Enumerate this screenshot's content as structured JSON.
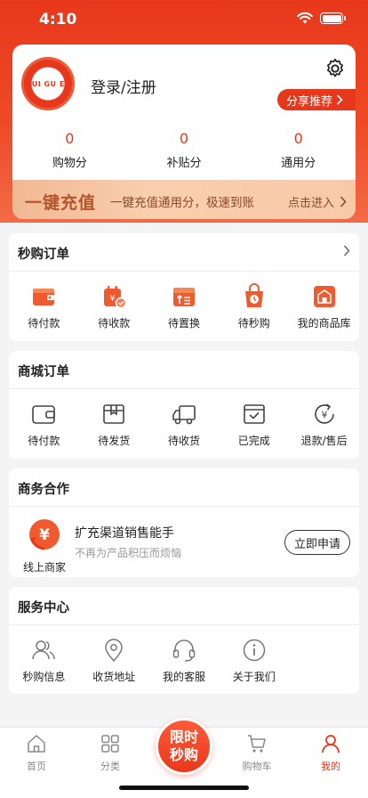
{
  "status_bar": {
    "time": "4:10"
  },
  "profile": {
    "logo_text": "HUI GU ER",
    "login_label": "登录/注册",
    "share_label": "分享推荐",
    "stats": [
      {
        "value": "0",
        "label": "购物分"
      },
      {
        "value": "0",
        "label": "补贴分"
      },
      {
        "value": "0",
        "label": "通用分"
      }
    ]
  },
  "recharge": {
    "title": "一键充值",
    "desc": "一键充值通用分，极速到账",
    "enter": "点击进入"
  },
  "flash_orders": {
    "title": "秒购订单",
    "items": [
      {
        "label": "待付款",
        "icon": "wallet-icon"
      },
      {
        "label": "待收款",
        "icon": "calendar-money-icon"
      },
      {
        "label": "待置换",
        "icon": "exchange-icon"
      },
      {
        "label": "待秒购",
        "icon": "shopping-bag-clock-icon"
      },
      {
        "label": "我的商品库",
        "icon": "store-icon"
      }
    ]
  },
  "mall_orders": {
    "title": "商城订单",
    "items": [
      {
        "label": "待付款",
        "icon": "wallet-icon"
      },
      {
        "label": "待发货",
        "icon": "box-icon"
      },
      {
        "label": "待收货",
        "icon": "truck-icon"
      },
      {
        "label": "已完成",
        "icon": "check-tray-icon"
      },
      {
        "label": "退款/售后",
        "icon": "refund-icon"
      }
    ]
  },
  "business": {
    "title": "商务合作",
    "logo_label": "线上商家",
    "headline": "扩充渠道销售能手",
    "subline": "不再为产品积压而烦恼",
    "apply_label": "立即申请"
  },
  "service": {
    "title": "服务中心",
    "items": [
      {
        "label": "秒购信息",
        "icon": "users-icon"
      },
      {
        "label": "收货地址",
        "icon": "location-icon"
      },
      {
        "label": "我的客服",
        "icon": "headset-icon"
      },
      {
        "label": "关于我们",
        "icon": "info-icon"
      }
    ]
  },
  "tabbar": {
    "items": [
      {
        "label": "首页",
        "icon": "home-icon"
      },
      {
        "label": "分类",
        "icon": "grid-icon"
      },
      {
        "label": "购物车",
        "icon": "cart-icon"
      },
      {
        "label": "我的",
        "icon": "user-icon",
        "active": true
      }
    ],
    "center_line1": "限时",
    "center_line2": "秒购"
  },
  "colors": {
    "accent": "#e8381c",
    "recharge_bg": "#f8cfae",
    "page_bg": "#f4f4f4"
  }
}
